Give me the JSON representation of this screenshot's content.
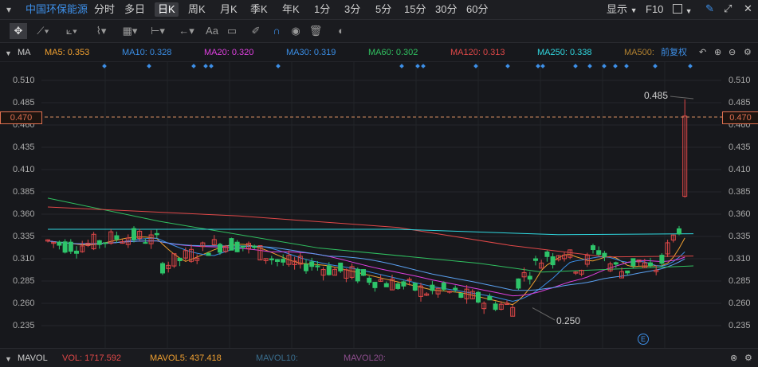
{
  "top": {
    "stock_name": "中国环保能源",
    "periods": [
      "分时",
      "多日",
      "日K",
      "周K",
      "月K",
      "季K",
      "年K",
      "1分",
      "3分",
      "5分",
      "15分",
      "30分",
      "60分"
    ],
    "selected_period": "日K",
    "display_label": "显示",
    "f10_label": "F10"
  },
  "toolbar": {
    "icons": [
      "move-icon",
      "line-icon",
      "ray-icon",
      "wave-icon",
      "fib-icon",
      "range-icon",
      "arrow-icon",
      "text-icon",
      "comment-icon",
      "pen-icon",
      "magnet-icon",
      "eye-icon",
      "trash-icon",
      "toggle-icon"
    ],
    "text_tool_label": "Aa"
  },
  "ma": {
    "label": "MA",
    "items": [
      {
        "text": "MA5: 0.353",
        "color": "#f0a030"
      },
      {
        "text": "MA10: 0.328",
        "color": "#3a8ee6"
      },
      {
        "text": "MA20: 0.320",
        "color": "#e040e0"
      },
      {
        "text": "MA30: 0.319",
        "color": "#3a8ee6"
      },
      {
        "text": "MA60: 0.302",
        "color": "#30c060"
      },
      {
        "text": "MA120: 0.313",
        "color": "#e04848"
      },
      {
        "text": "MA250: 0.338",
        "color": "#30d8e0"
      },
      {
        "text": "MA500:",
        "color": "#b08030"
      }
    ],
    "adjust_label": "前复权"
  },
  "axis": {
    "ticks": [
      "0.510",
      "0.485",
      "0.460",
      "0.435",
      "0.410",
      "0.385",
      "0.360",
      "0.335",
      "0.310",
      "0.285",
      "0.260",
      "0.235"
    ],
    "current_price": "0.470",
    "high_label": "0.485",
    "low_label": "0.250"
  },
  "vol": {
    "label": "MAVOL",
    "items": [
      {
        "text": "VOL: 1717.592",
        "color": "#e04848"
      },
      {
        "text": "MAVOL5: 437.418",
        "color": "#f0a030"
      },
      {
        "text": "MAVOL10:",
        "color": "#3a6e8e"
      },
      {
        "text": "MAVOL20:",
        "color": "#8e4e8e"
      }
    ]
  },
  "colors": {
    "up": "#e04848",
    "down": "#2ec46a",
    "accent": "#3d8fe8"
  },
  "chart_data": {
    "type": "candlestick",
    "price_range": [
      0.225,
      0.52
    ],
    "last_close": 0.47,
    "high": 0.485,
    "low": 0.25
  }
}
